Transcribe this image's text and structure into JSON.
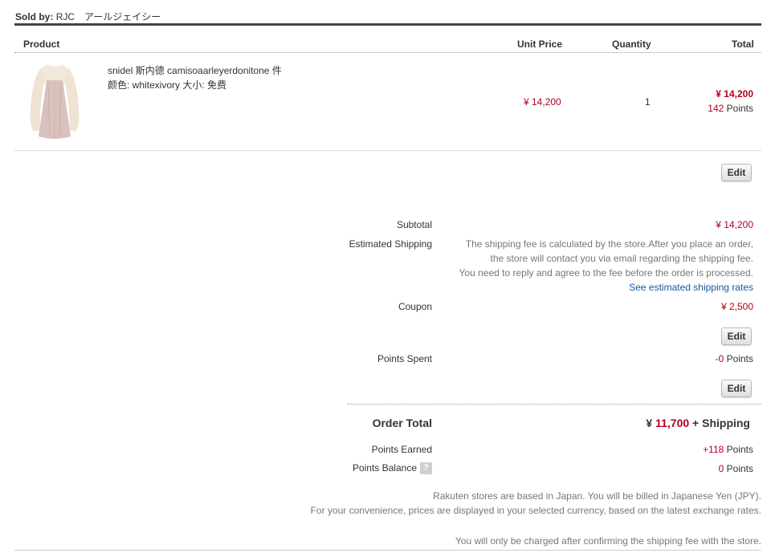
{
  "seller": {
    "prefix": "Sold by:",
    "name": "RJC　アールジェイシー"
  },
  "table": {
    "headers": {
      "product": "Product",
      "unit_price": "Unit Price",
      "quantity": "Quantity",
      "total": "Total"
    }
  },
  "item": {
    "title": "snidel 斯内德 camisoaarleyerdonitone 件",
    "options": "颜色: whitexivory 大小: 免费",
    "unit_price": "¥ 14,200",
    "quantity": "1",
    "total": "¥ 14,200",
    "points_value": "142",
    "points_label": "Points",
    "edit_label": "Edit"
  },
  "summary": {
    "subtotal_label": "Subtotal",
    "subtotal_value": "¥ 14,200",
    "shipping_label": "Estimated Shipping",
    "shipping_note_1": "The shipping fee is calculated by the store.After you place an order,",
    "shipping_note_2": "the store will contact you via email regarding the shipping fee.",
    "shipping_note_3": "You need to reply and agree to the fee before the order is processed.",
    "shipping_link": "See estimated shipping rates",
    "coupon_label": "Coupon",
    "coupon_value": "¥ 2,500",
    "coupon_edit": "Edit",
    "points_spent_label": "Points Spent",
    "points_spent_value": "-0",
    "points_spent_unit": "Points",
    "points_edit": "Edit",
    "order_total_label": "Order Total",
    "order_total_currency": "¥",
    "order_total_value": "11,700",
    "order_total_suffix": "+ Shipping",
    "points_earned_label": "Points Earned",
    "points_earned_value": "+118",
    "points_earned_unit": "Points",
    "points_balance_label": "Points Balance",
    "points_balance_help": "?",
    "points_balance_value": "0",
    "points_balance_unit": "Points"
  },
  "footer": {
    "note_1": "Rakuten stores are based in Japan. You will be billed in Japanese Yen (JPY).",
    "note_2": "For your convenience, prices are displayed in your selected currency, based on the latest exchange rates.",
    "note_3": "You will only be charged after confirming the shipping fee with the store."
  },
  "colors": {
    "price_red": "#b0001e",
    "link_blue": "#1a57a5",
    "rule_dark": "#444444"
  }
}
